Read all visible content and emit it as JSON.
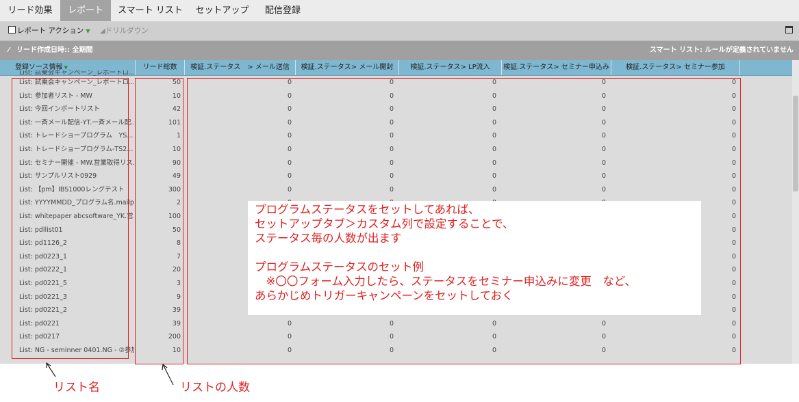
{
  "tabs": [
    {
      "label": "リード効果",
      "active": false
    },
    {
      "label": "レポート",
      "active": true
    },
    {
      "label": "スマート リスト",
      "active": false
    },
    {
      "label": "セットアップ",
      "active": false
    },
    {
      "label": "配信登録",
      "active": false
    }
  ],
  "toolbar": {
    "report_actions": "レポート アクション",
    "drilldown": "ドリルダウン"
  },
  "filter": {
    "left": "リード作成日時:: 全期間",
    "right": "スマート リスト: ルールが定義されていません"
  },
  "table": {
    "headers": [
      "登録ソース情報",
      "リード総数",
      "検証.ステータス　> メール送信",
      "検証.ステータス> メール開封",
      "検証.ステータス> LP流入",
      "検証.ステータス> セミナー申込み",
      "検証.ステータス> セミナー参加"
    ],
    "partial_top_row": "List: 試乗会キャンペーン_レポートロ...",
    "rows": [
      {
        "name": "List: 試乗会キャンペーン_レポートロ...",
        "total": "50",
        "v1": "0",
        "v2": "0",
        "v3": "0",
        "v4": "0",
        "v5": "0"
      },
      {
        "name": "List: 参加者リスト - MW",
        "total": "10",
        "v1": "0",
        "v2": "0",
        "v3": "0",
        "v4": "0",
        "v5": "0"
      },
      {
        "name": "List: 今回インポートリスト",
        "total": "42",
        "v1": "0",
        "v2": "0",
        "v3": "0",
        "v4": "0",
        "v5": "0"
      },
      {
        "name": "List: 一斉メール配信-YT.一斉メール配...",
        "total": "101",
        "v1": "0",
        "v2": "0",
        "v3": "0",
        "v4": "0",
        "v5": "0"
      },
      {
        "name": "List: トレードショープログラム　YS...",
        "total": "1",
        "v1": "0",
        "v2": "0",
        "v3": "0",
        "v4": "0",
        "v5": "0"
      },
      {
        "name": "List: トレードショープログラム-TS2...",
        "total": "10",
        "v1": "0",
        "v2": "0",
        "v3": "0",
        "v4": "0",
        "v5": "0"
      },
      {
        "name": "List: セミナー開催 - MW.営業取得リス...",
        "total": "90",
        "v1": "0",
        "v2": "0",
        "v3": "0",
        "v4": "0",
        "v5": "0"
      },
      {
        "name": "List: サンプルリスト0929",
        "total": "49",
        "v1": "0",
        "v2": "0",
        "v3": "0",
        "v4": "0",
        "v5": "0"
      },
      {
        "name": "List: 【pm】IBS1000レングテスト",
        "total": "300",
        "v1": "0",
        "v2": "0",
        "v3": "0",
        "v4": "0",
        "v5": "0"
      },
      {
        "name": "List: YYYYMMDD_プログラム名.mailp...",
        "total": "2",
        "v1": "0",
        "v2": "0",
        "v3": "0",
        "v4": "0",
        "v5": "0"
      },
      {
        "name": "List: whitepaper abcsoftware_YK.営...",
        "total": "100",
        "v1": "0",
        "v2": "0",
        "v3": "0",
        "v4": "0",
        "v5": "0"
      },
      {
        "name": "List: pdllist01",
        "total": "50",
        "v1": "0",
        "v2": "0",
        "v3": "0",
        "v4": "0",
        "v5": "0"
      },
      {
        "name": "List: pd1126_2",
        "total": "8",
        "v1": "0",
        "v2": "0",
        "v3": "0",
        "v4": "0",
        "v5": "0"
      },
      {
        "name": "List: pd0223_1",
        "total": "7",
        "v1": "0",
        "v2": "0",
        "v3": "0",
        "v4": "0",
        "v5": "0"
      },
      {
        "name": "List: pd0222_1",
        "total": "20",
        "v1": "0",
        "v2": "0",
        "v3": "0",
        "v4": "0",
        "v5": "0"
      },
      {
        "name": "List: pd0221_5",
        "total": "3",
        "v1": "0",
        "v2": "0",
        "v3": "0",
        "v4": "0",
        "v5": "0"
      },
      {
        "name": "List: pd0221_3",
        "total": "9",
        "v1": "0",
        "v2": "0",
        "v3": "0",
        "v4": "0",
        "v5": "0"
      },
      {
        "name": "List: pd0221_2",
        "total": "39",
        "v1": "0",
        "v2": "0",
        "v3": "0",
        "v4": "0",
        "v5": "0"
      },
      {
        "name": "List: pd0221",
        "total": "39",
        "v1": "0",
        "v2": "0",
        "v3": "0",
        "v4": "0",
        "v5": "0"
      },
      {
        "name": "List: pd0217",
        "total": "200",
        "v1": "0",
        "v2": "0",
        "v3": "0",
        "v4": "0",
        "v5": "0"
      },
      {
        "name": "List: NG - seminner 0401.NG - ②参加...",
        "total": "10",
        "v1": "0",
        "v2": "0",
        "v3": "0",
        "v4": "0",
        "v5": "0"
      }
    ]
  },
  "note": [
    "プログラムステータスをセットしてあれば、",
    "セットアップタブ＞カスタム列で設定することで、",
    "ステータス毎の人数が出ます",
    "",
    "プログラムステータスのセット例",
    "　※〇〇フォーム入力したら、ステータスをセミナー申込みに変更　など、",
    "あらかじめトリガーキャンペーンをセットしておく"
  ],
  "annotations": {
    "list_name": "リスト名",
    "list_count": "リストの人数"
  },
  "colors": {
    "header_bg": "#7fb7d1",
    "annotation_red": "#e02020",
    "active_tab_bg": "#a3a3a3"
  }
}
